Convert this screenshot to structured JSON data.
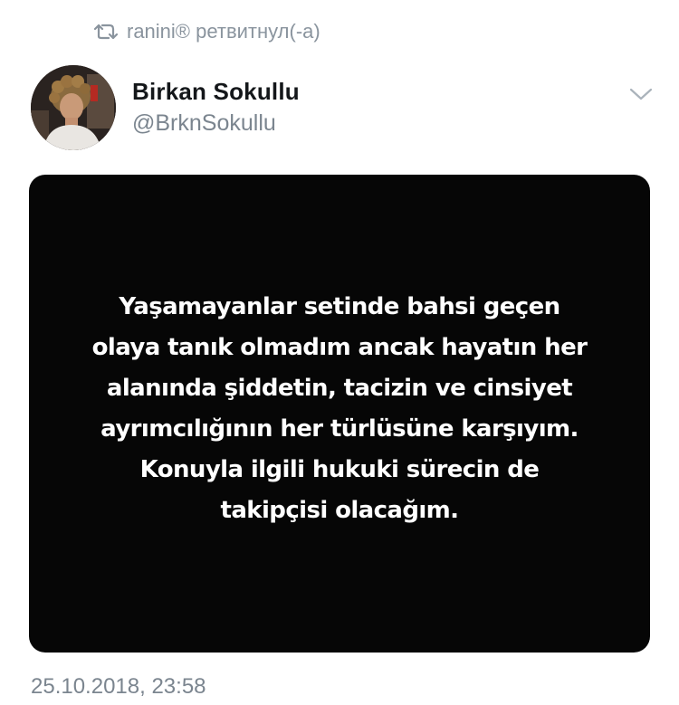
{
  "retweet": {
    "icon": "retweet-icon",
    "text": "ranini® ретвитнул(-а)"
  },
  "author": {
    "name": "Birkan Sokullu",
    "handle": "@BrknSokullu",
    "avatar_icon": "avatar-photo"
  },
  "menu": {
    "icon": "chevron-down-icon"
  },
  "media": {
    "background": "#060606",
    "text_color": "#ffffff",
    "lines": [
      "Yaşamayanlar setinde bahsi geçen",
      "olaya tanık olmadım ancak hayatın her",
      "alanında şiddetin, tacizin ve cinsiyet",
      "ayrımcılığının her türlüsüne karşıyım.",
      "Konuyla ilgili hukuki sürecin de",
      "takipçisi olacağım."
    ]
  },
  "timestamp": "25.10.2018, 23:58",
  "colors": {
    "secondary_text": "#7b858f",
    "primary_text": "#14171a"
  }
}
